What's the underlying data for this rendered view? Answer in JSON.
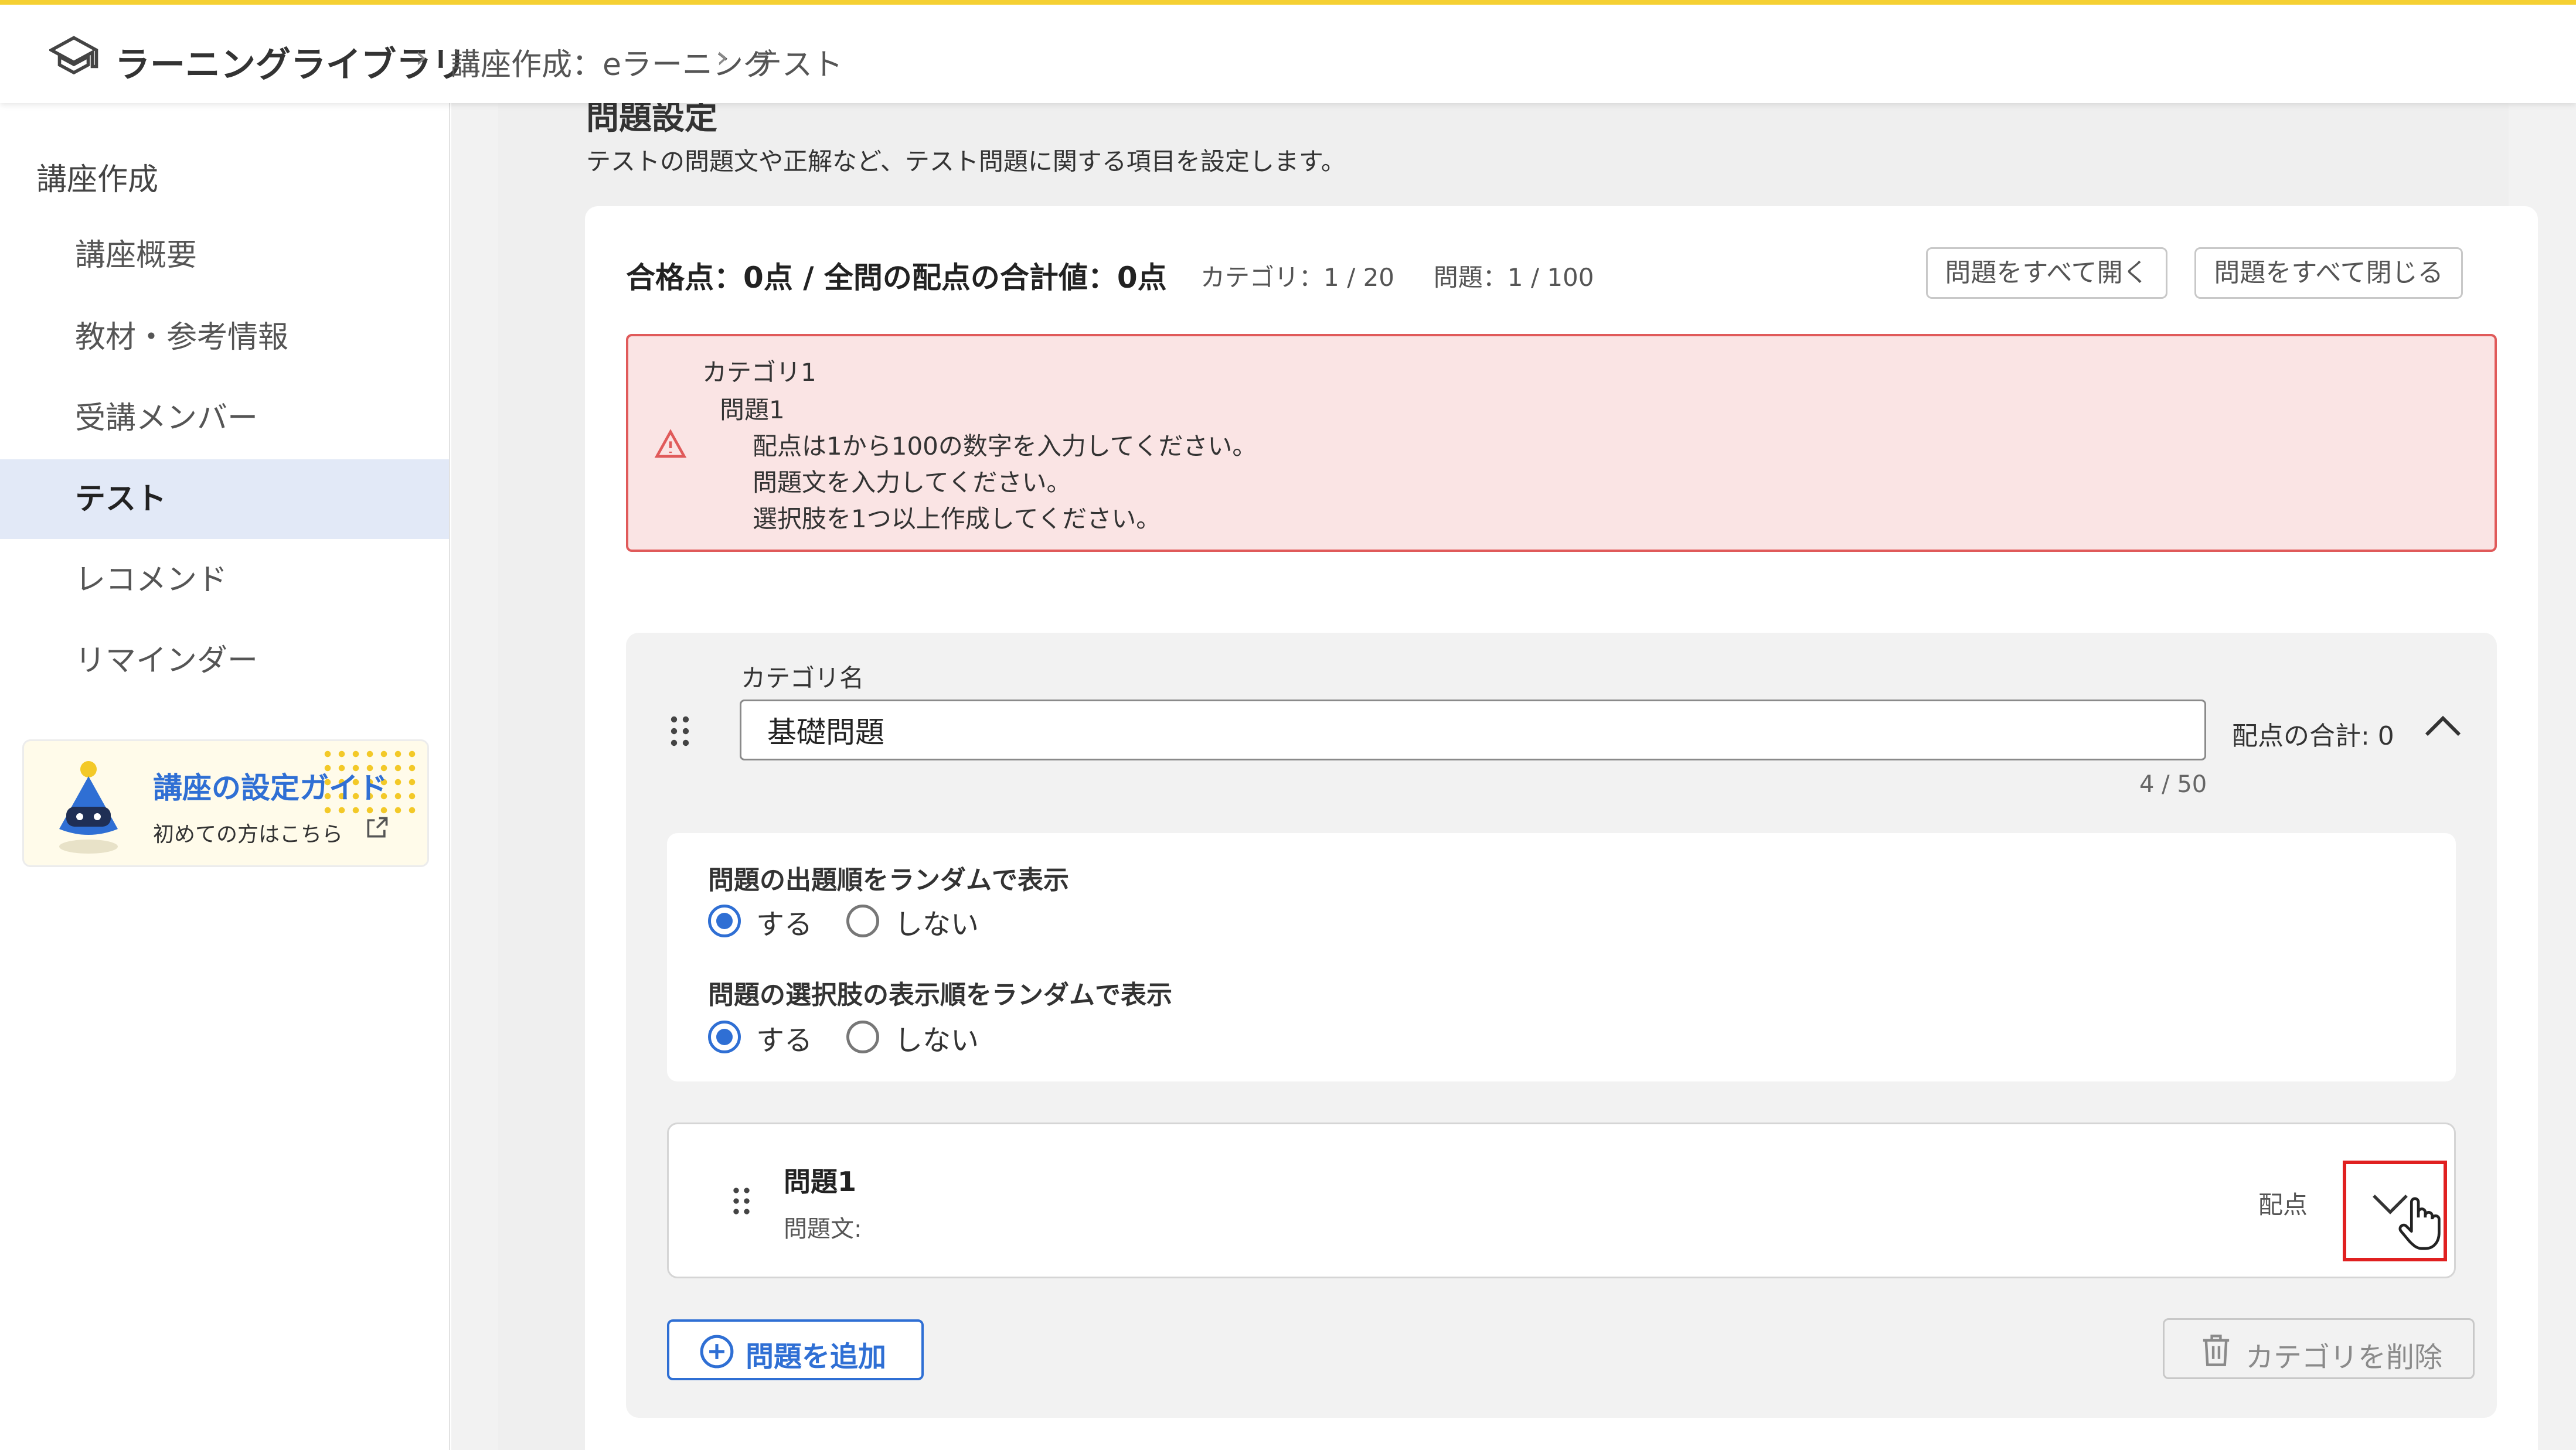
{
  "breadcrumb": {
    "home": "ラーニングライブラリ",
    "section": "講座作成：eラーニング",
    "current": "テスト"
  },
  "sidebar": {
    "section_title": "講座作成",
    "items": [
      {
        "label": "講座概要",
        "active": false
      },
      {
        "label": "教材・参考情報",
        "active": false
      },
      {
        "label": "受講メンバー",
        "active": false
      },
      {
        "label": "テスト",
        "active": true
      },
      {
        "label": "レコメンド",
        "active": false
      },
      {
        "label": "リマインダー",
        "active": false
      }
    ],
    "guide": {
      "title": "講座の設定ガイド",
      "subtitle": "初めての方はこちら"
    }
  },
  "main": {
    "heading": "問題設定",
    "description": "テストの問題文や正解など、テスト問題に関する項目を設定します。",
    "summary": "合格点：0点 / 全問の配点の合計値：0点",
    "counts": {
      "category": "カテゴリ：1 / 20",
      "question": "問題：1 / 100"
    },
    "buttons": {
      "open_all": "問題をすべて開く",
      "close_all": "問題をすべて閉じる"
    },
    "alert": {
      "lines": [
        "カテゴリ1",
        "問題1",
        "配点は1から100の数字を入力してください。",
        "問題文を入力してください。",
        "選択肢を1つ以上作成してください。"
      ]
    },
    "category": {
      "label": "カテゴリ名",
      "name_value": "基礎問題",
      "score_total": "配点の合計: 0",
      "char_count": "4 / 50",
      "random_order": {
        "title": "問題の出題順をランダムで表示",
        "yes": "する",
        "no": "しない",
        "selected": "する"
      },
      "random_choices": {
        "title": "問題の選択肢の表示順をランダムで表示",
        "yes": "する",
        "no": "しない",
        "selected": "する"
      },
      "question": {
        "title": "問題1",
        "text_label": "問題文:",
        "score_label": "配点"
      },
      "add_question": "問題を追加",
      "delete_category": "カテゴリを削除"
    }
  },
  "colors": {
    "accent": "#2f6fd4",
    "alert_border": "#e05a5a",
    "alert_bg": "#fae4e4",
    "topbar_line": "#f5d033",
    "highlight": "#e02020"
  }
}
